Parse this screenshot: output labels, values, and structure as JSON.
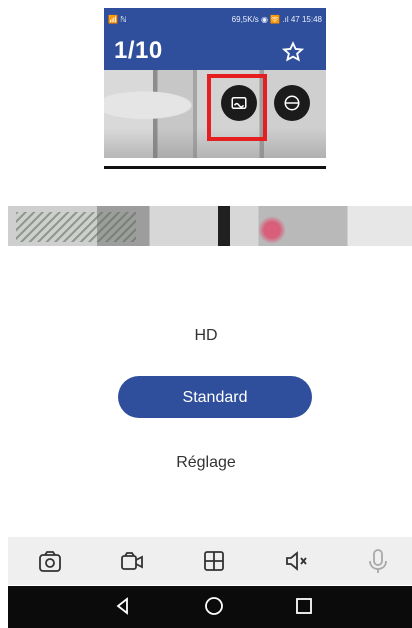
{
  "inset": {
    "status_left": "📶 ℕ",
    "status_right": "69,5K/s ◉ 🛜 .ıl 47 15:48",
    "title": "1/10",
    "star_icon": "star-outline-icon",
    "button_1_icon": "image-icon",
    "button_2_icon": "ptz-dome-icon",
    "highlight_color": "#e51f1f"
  },
  "menu": {
    "hd_label": "HD",
    "standard_label": "Standard",
    "reglage_label": "Réglage"
  },
  "toolbar": {
    "items": [
      {
        "icon": "camera-icon"
      },
      {
        "icon": "video-icon"
      },
      {
        "icon": "grid-icon"
      },
      {
        "icon": "mute-icon"
      },
      {
        "icon": "microphone-icon"
      }
    ]
  },
  "navigation": {
    "back_icon": "back-triangle-icon",
    "home_icon": "home-circle-icon",
    "recent_icon": "recent-square-icon"
  },
  "colors": {
    "primary": "#2f4f9c",
    "toolbar_bg": "#efefef",
    "navbar_bg": "#0b0b0b",
    "text": "#333333",
    "disabled_icon": "#a8a8a8"
  }
}
